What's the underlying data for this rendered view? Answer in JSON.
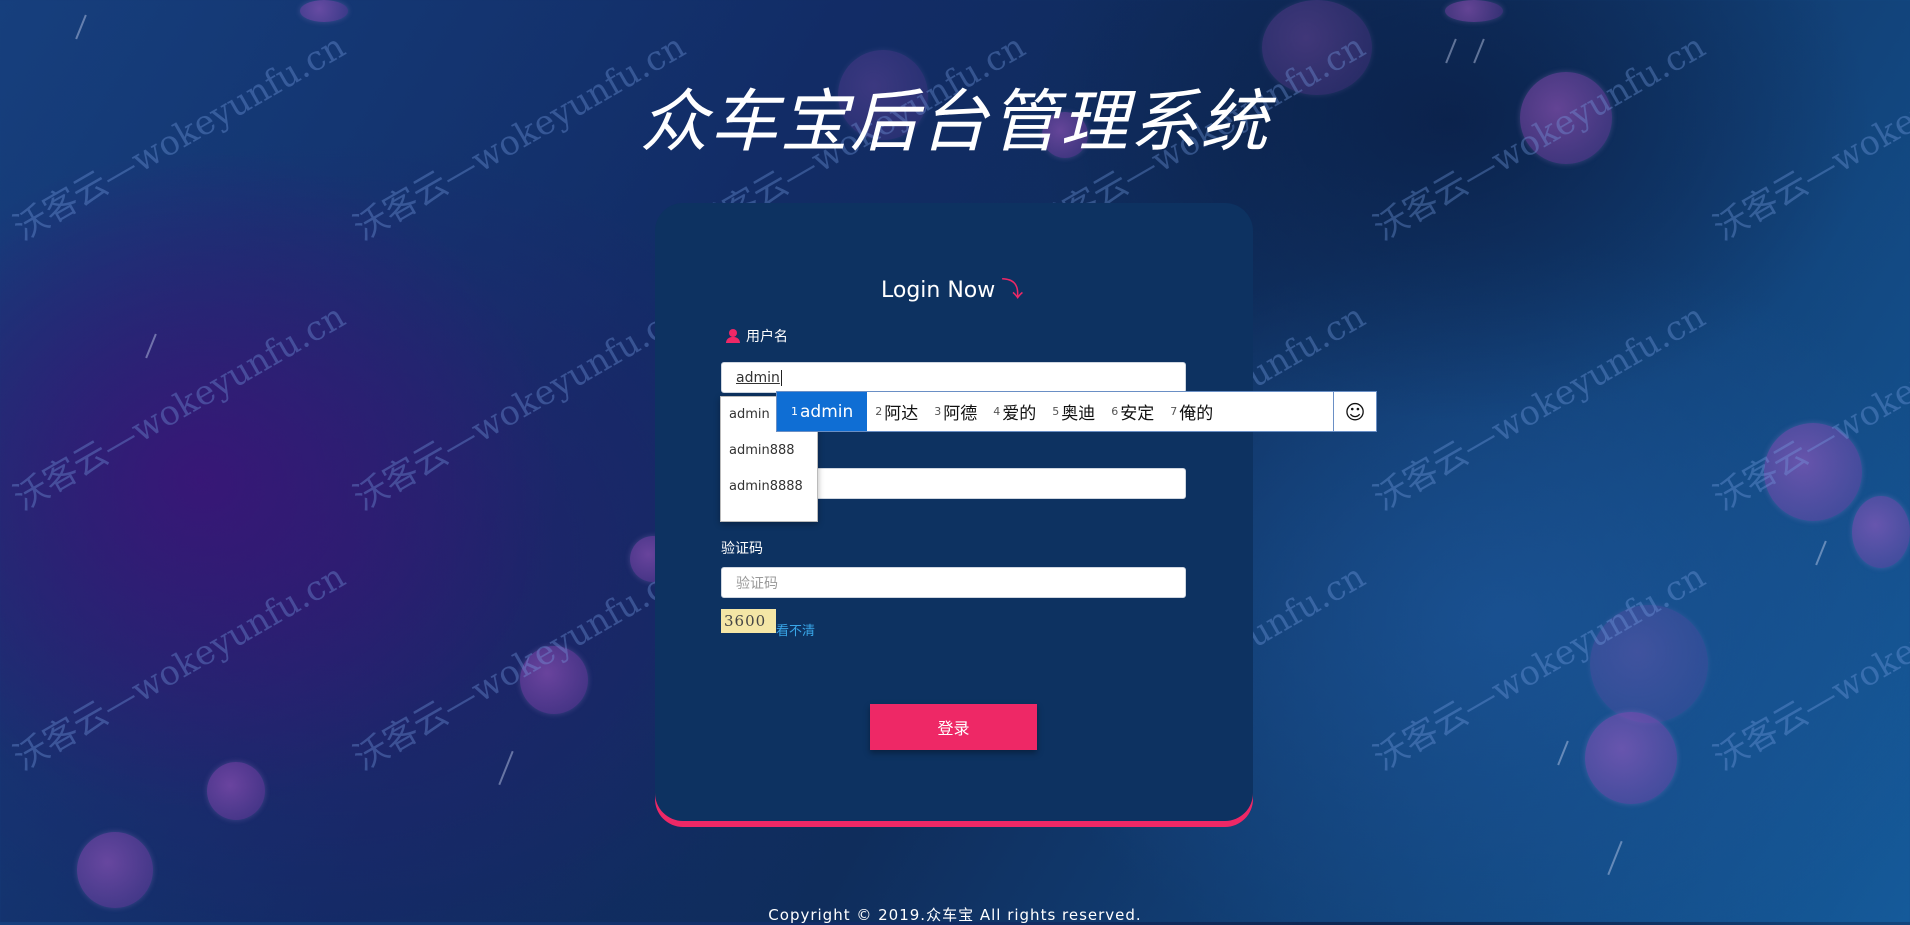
{
  "app_title": "众车宝后台管理系统",
  "login": {
    "heading": "Login Now",
    "heading_icon": "arrow-down-icon",
    "username_label": "用户名",
    "username_value": "admin",
    "captcha_label": "验证码",
    "captcha_placeholder": "验证码",
    "captcha_image_text": "3600",
    "captcha_refresh_link": "看不清",
    "submit_label": "登录"
  },
  "autocomplete": {
    "items": [
      "admin",
      "admin888",
      "admin8888"
    ]
  },
  "ime": {
    "candidates": [
      {
        "num": "1",
        "text": "admin"
      },
      {
        "num": "2",
        "text": "阿达"
      },
      {
        "num": "3",
        "text": "阿德"
      },
      {
        "num": "4",
        "text": "爱的"
      },
      {
        "num": "5",
        "text": "奥迪"
      },
      {
        "num": "6",
        "text": "安定"
      },
      {
        "num": "7",
        "text": "俺的"
      }
    ],
    "emoji_icon": "☺"
  },
  "footer": "Copyright © 2019.众车宝 All rights reserved.",
  "watermark": "沃客云—wokeyunfu.cn",
  "colors": {
    "accent": "#ee2866",
    "card": "#0d3261",
    "ime_selected": "#0f6ed4",
    "link": "#39a6e8"
  }
}
